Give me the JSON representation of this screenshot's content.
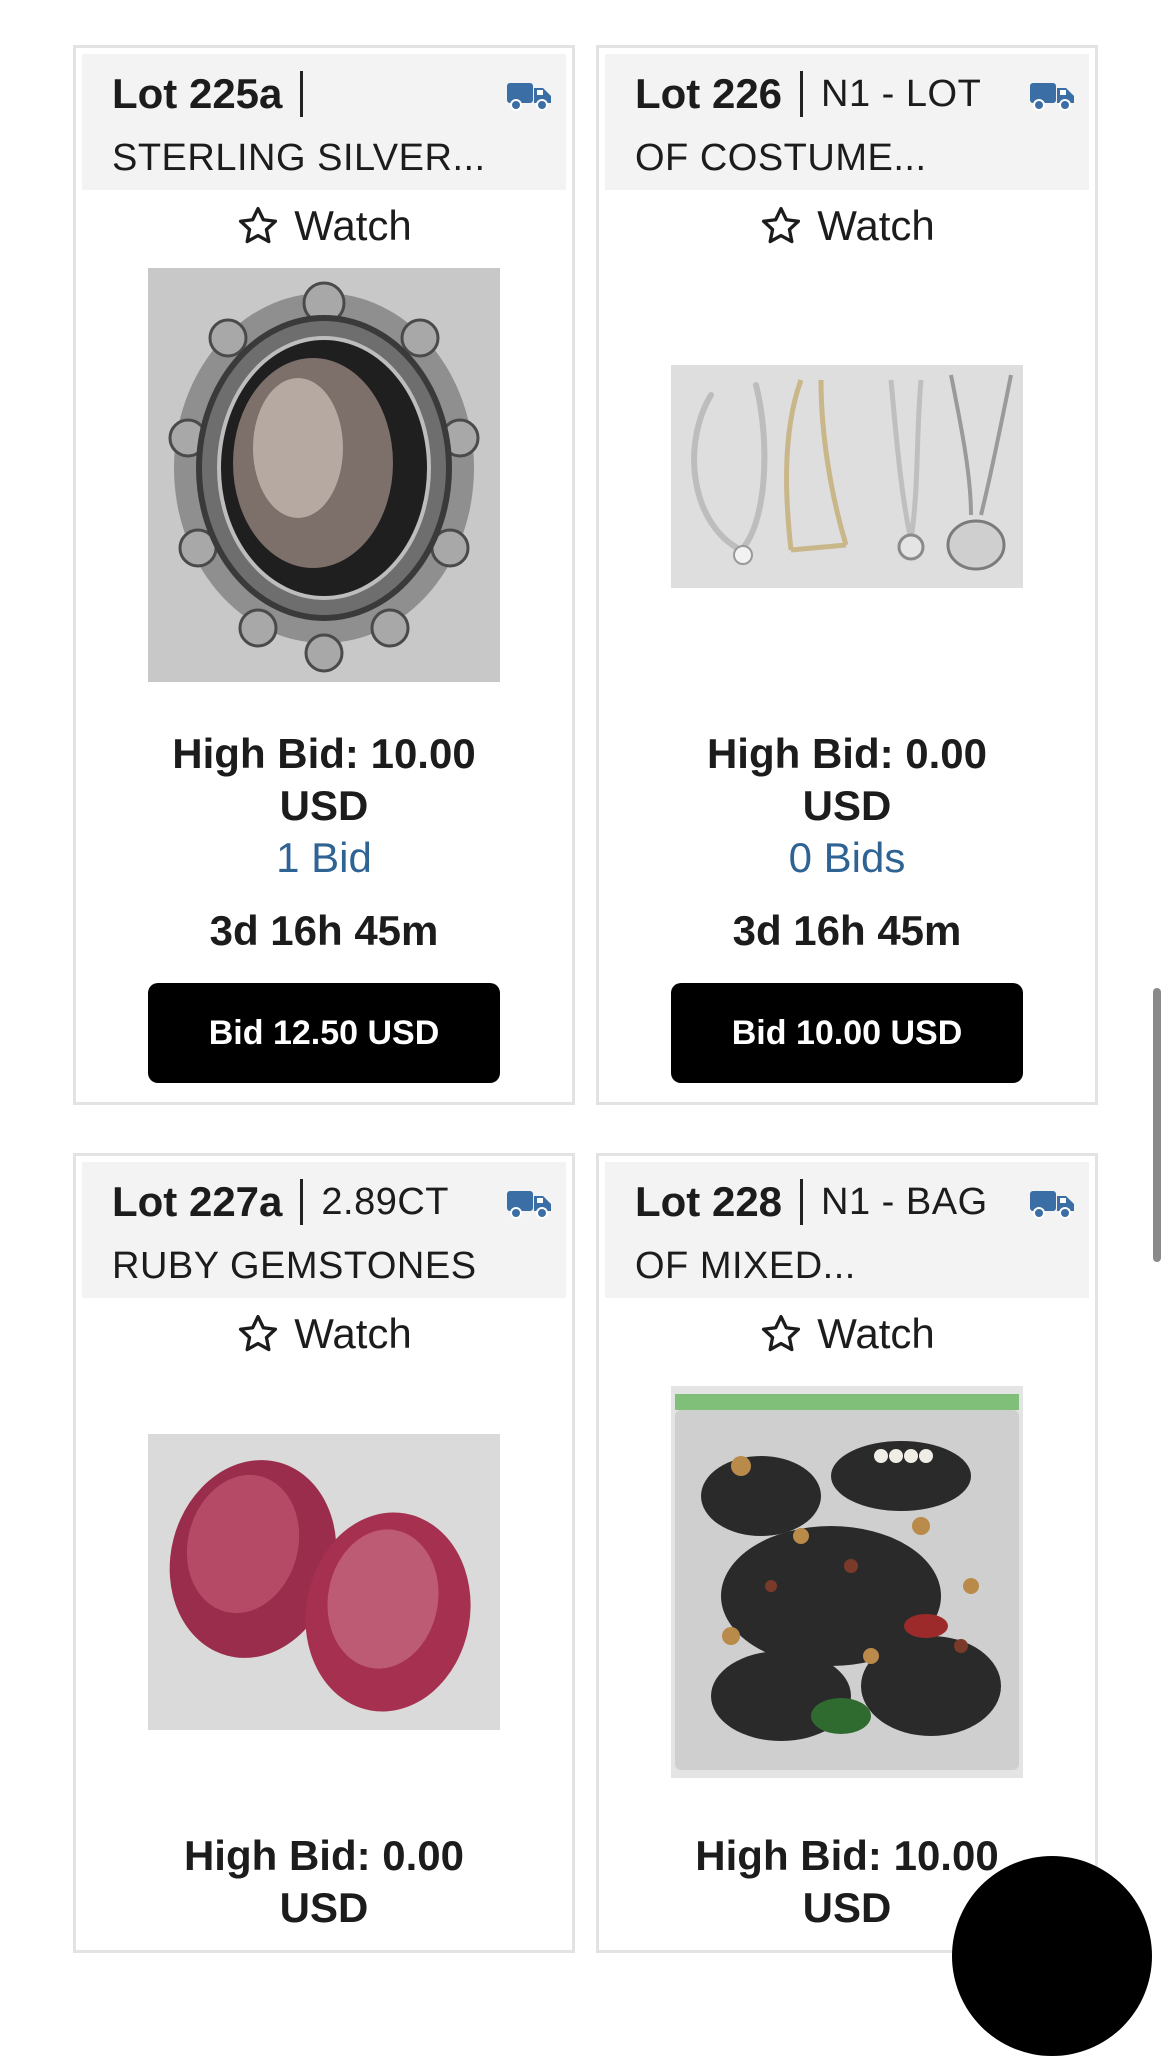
{
  "watch_label": "Watch",
  "colors": {
    "truck": "#3b6ea5",
    "bid_count": "#2f6394",
    "button_bg": "#000000",
    "header_bg": "#f3f3f3"
  },
  "lots": [
    {
      "lot_number": "Lot 225a",
      "title_line1": "",
      "title_line2": "STERLING SILVER...",
      "image": "silver-ring-photo",
      "high_bid_line1": "High Bid: 10.00",
      "high_bid_line2": "USD",
      "bid_count": "1 Bid",
      "time_left": "3d 16h 45m",
      "bid_button": "Bid 12.50 USD"
    },
    {
      "lot_number": "Lot 226",
      "title_line1": "N1 - LOT",
      "title_line2": "OF COSTUME...",
      "image": "necklaces-photo",
      "high_bid_line1": "High Bid: 0.00",
      "high_bid_line2": "USD",
      "bid_count": "0 Bids",
      "time_left": "3d 16h 45m",
      "bid_button": "Bid 10.00 USD"
    },
    {
      "lot_number": "Lot 227a",
      "title_line1": "2.89CT",
      "title_line2": "RUBY GEMSTONES",
      "image": "ruby-gemstones-photo",
      "high_bid_line1": "High Bid: 0.00",
      "high_bid_line2": "USD"
    },
    {
      "lot_number": "Lot 228",
      "title_line1": "N1 - BAG",
      "title_line2": "OF MIXED...",
      "image": "jewelry-bag-photo",
      "high_bid_line1": "High Bid: 10.00",
      "high_bid_line2": "USD"
    }
  ]
}
